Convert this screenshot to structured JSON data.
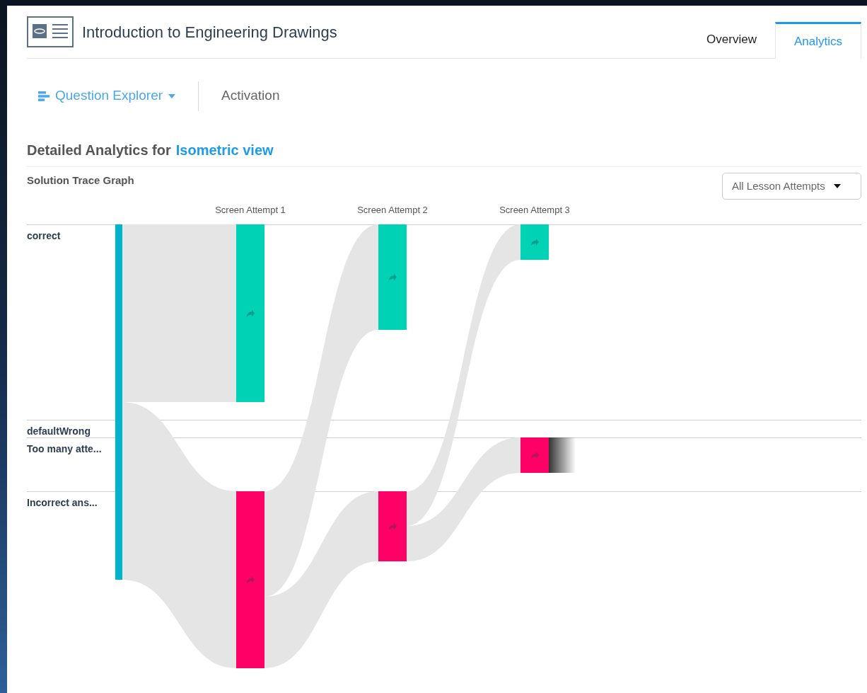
{
  "course": {
    "title": "Introduction to Engineering Drawings"
  },
  "tabs": [
    {
      "label": "Overview",
      "selected": false
    },
    {
      "label": "Analytics",
      "selected": true
    }
  ],
  "nav": [
    {
      "label": "Question Explorer",
      "selected": true,
      "kind": "menu"
    },
    {
      "label": "Activation",
      "selected": false,
      "kind": "link"
    }
  ],
  "heading": {
    "text": "Detailed Analytics for",
    "link": "Isometric view"
  },
  "graph": {
    "title": "Solution Trace Graph",
    "filter": "All Lesson Attempts",
    "columns": [
      "Screen Attempt 1",
      "Screen Attempt 2",
      "Screen Attempt 3"
    ],
    "rows": [
      "correct",
      "defaultWrong",
      "Too many atte...",
      "Incorrect ans..."
    ]
  }
}
